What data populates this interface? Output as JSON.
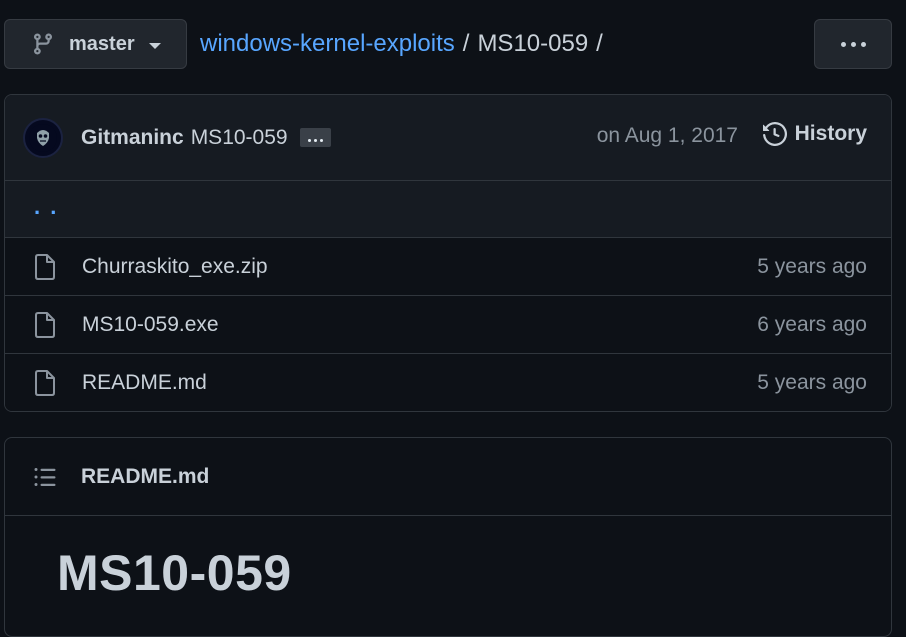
{
  "branch": {
    "name": "master",
    "icon": "git-branch-icon"
  },
  "breadcrumb": {
    "repo": "windows-kernel-exploits",
    "separator": "/",
    "directory": "MS10-059",
    "trailing_separator": "/"
  },
  "more_menu": {
    "icon": "kebab-horizontal-icon"
  },
  "commit": {
    "author": "Gitmaninc",
    "message": "MS10-059",
    "date": "on Aug 1, 2017",
    "history_label": "History"
  },
  "parent_dir": {
    "label": ". ."
  },
  "files": [
    {
      "name": "Churraskito_exe.zip",
      "age": "5 years ago",
      "icon": "file-icon"
    },
    {
      "name": "MS10-059.exe",
      "age": "6 years ago",
      "icon": "file-icon"
    },
    {
      "name": "README.md",
      "age": "5 years ago",
      "icon": "file-icon"
    }
  ],
  "readme": {
    "title": "README.md",
    "heading": "MS10-059"
  },
  "colors": {
    "background": "#0d1117",
    "accent_link": "#58a6ff",
    "text": "#c9d1d9",
    "muted": "#8b949e",
    "border": "#30363d"
  }
}
